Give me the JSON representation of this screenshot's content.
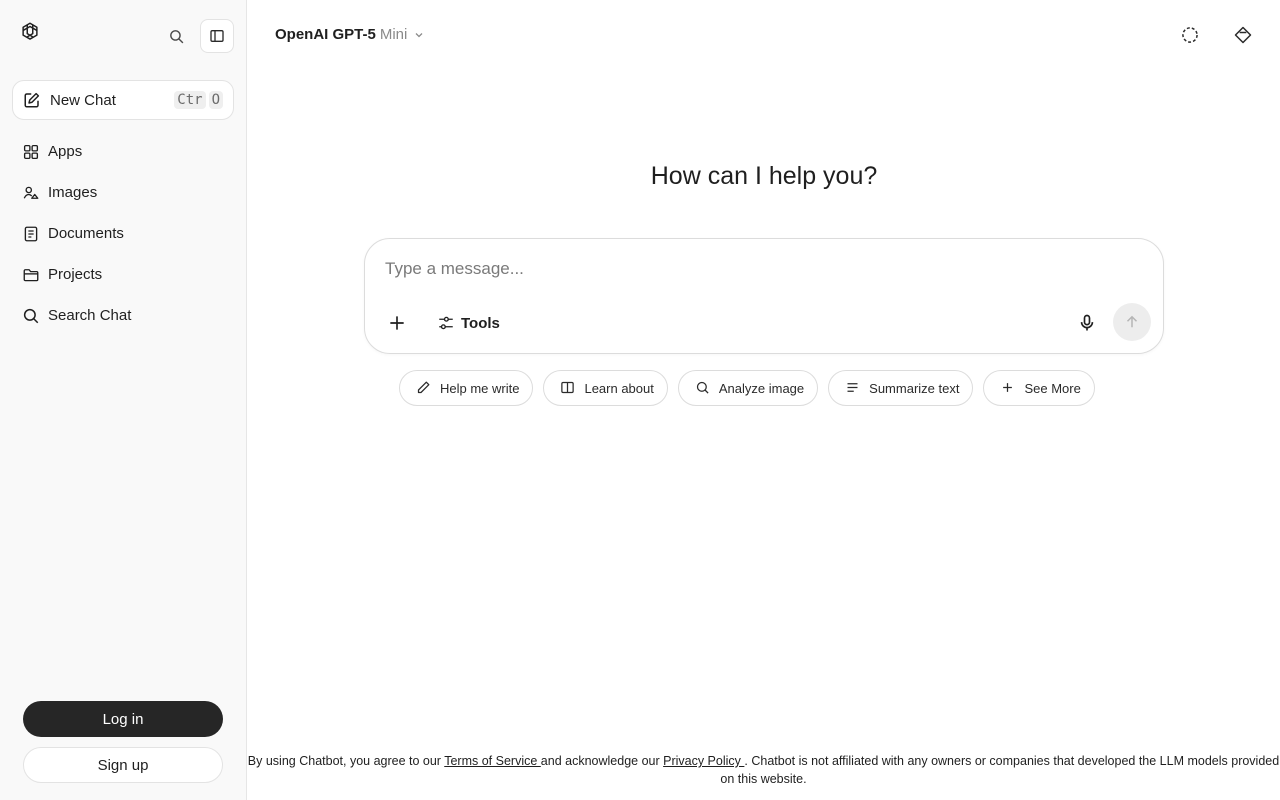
{
  "sidebar": {
    "new_chat": {
      "label": "New Chat",
      "shortcut_keys": [
        "Ctr",
        "O"
      ]
    },
    "items": [
      {
        "label": "Apps",
        "icon": "grid-icon"
      },
      {
        "label": "Images",
        "icon": "images-icon"
      },
      {
        "label": "Documents",
        "icon": "document-icon"
      },
      {
        "label": "Projects",
        "icon": "folder-icon"
      },
      {
        "label": "Search Chat",
        "icon": "search-icon"
      }
    ],
    "login_label": "Log in",
    "signup_label": "Sign up"
  },
  "header": {
    "model_name": "OpenAI GPT-5",
    "model_variant": "Mini"
  },
  "main": {
    "headline": "How can I help you?",
    "composer": {
      "placeholder": "Type a message...",
      "tools_label": "Tools"
    },
    "chips": [
      {
        "label": "Help me write",
        "icon": "pencil-icon"
      },
      {
        "label": "Learn about",
        "icon": "book-icon"
      },
      {
        "label": "Analyze image",
        "icon": "magnifier-icon"
      },
      {
        "label": "Summarize text",
        "icon": "lines-icon"
      },
      {
        "label": "See More",
        "icon": "plus-icon"
      }
    ]
  },
  "footer": {
    "prefix": "By using Chatbot, you agree to our ",
    "terms_label": "Terms of Service ",
    "middle": "and acknowledge our ",
    "privacy_label": "Privacy Policy ",
    "suffix": ". Chatbot is not affiliated with any owners or companies that developed the LLM models provided on this website."
  }
}
